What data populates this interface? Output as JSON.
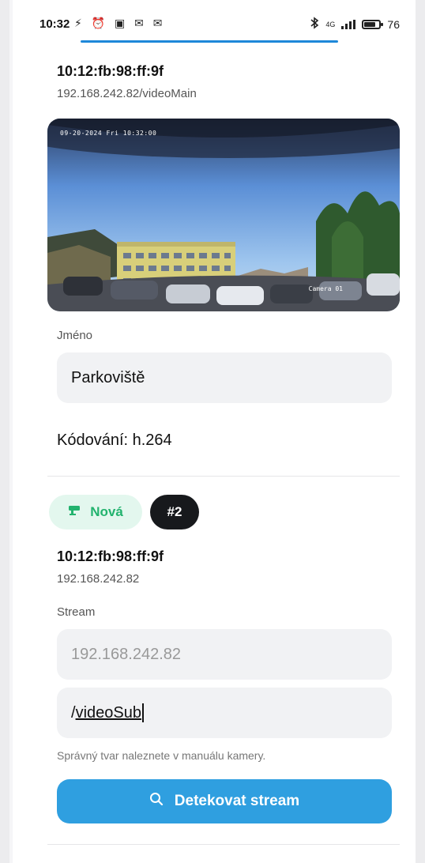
{
  "status_bar": {
    "time": "10:32",
    "left_icons": "⚡ ⏰ ▣ ✉ ✉",
    "network": "4G",
    "battery_percent": "76",
    "battery_level": 0.76,
    "page_load_progress": 0.64
  },
  "stream_main": {
    "mac": "10:12:fb:98:ff:9f",
    "url": "192.168.242.82/videoMain",
    "preview_timestamp": "09-20-2024 Fri 10:32:00",
    "preview_camera_label": "Camera 01",
    "name_label": "Jméno",
    "name_value": "Parkoviště",
    "encoding": "Kódování: h.264"
  },
  "stream_new": {
    "badge_label": "Nová",
    "index_badge": "#2",
    "mac": "10:12:fb:98:ff:9f",
    "ip": "192.168.242.82",
    "stream_label": "Stream",
    "ip_field_value": "192.168.242.82",
    "path_prefix": "/",
    "path_value": "videoSub",
    "hint": "Správný tvar naleznete v manuálu kamery.",
    "detect_button": "Detekovat stream"
  },
  "colors": {
    "accent_blue": "#2f9fe0",
    "badge_green": "#22b36e",
    "badge_green_bg": "#e3f7ee",
    "dark_badge": "#17191c"
  },
  "icons": {
    "status_left": "status-notification-icons",
    "bluetooth": "bluetooth-icon",
    "signal": "signal-icon",
    "battery": "battery-icon",
    "badge": "camera-icon",
    "search": "search-icon"
  }
}
